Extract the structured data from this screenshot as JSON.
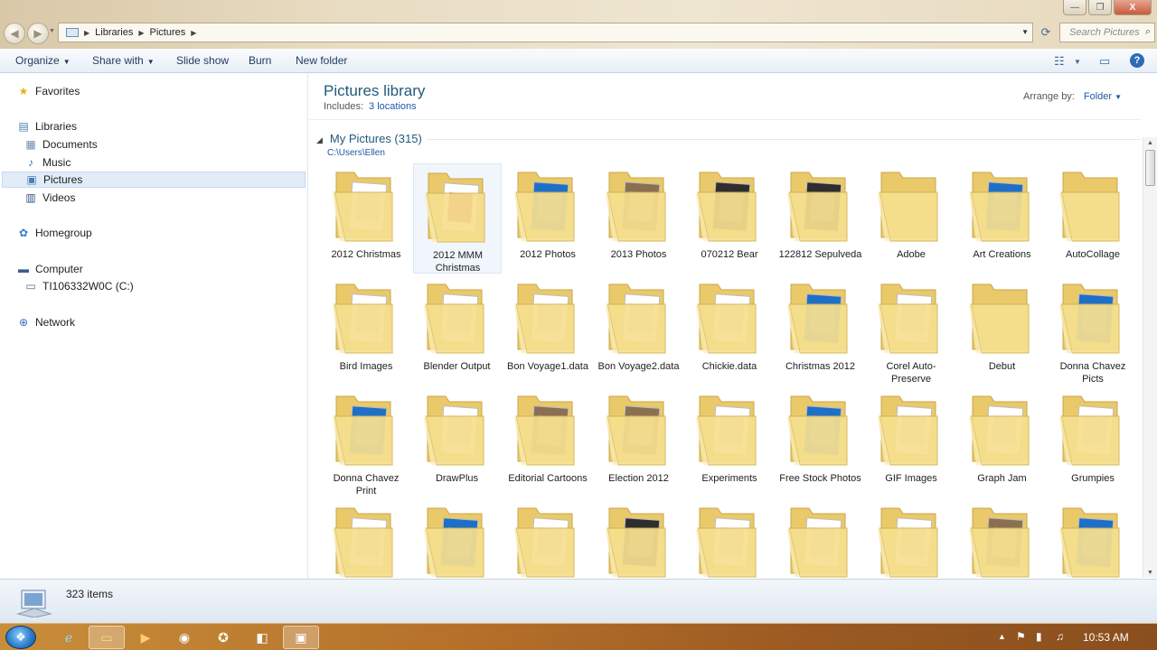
{
  "window": {
    "breadcrumb": [
      "Libraries",
      "Pictures"
    ],
    "search_placeholder": "Search Pictures",
    "buttons": {
      "minimize": "—",
      "maximize": "❐",
      "close": "X"
    }
  },
  "commands": {
    "organize": "Organize",
    "share_with": "Share with",
    "slide_show": "Slide show",
    "burn": "Burn",
    "new_folder": "New folder"
  },
  "nav": {
    "favorites": "Favorites",
    "libraries": "Libraries",
    "documents": "Documents",
    "music": "Music",
    "pictures": "Pictures",
    "videos": "Videos",
    "homegroup": "Homegroup",
    "computer": "Computer",
    "drive": "TI106332W0C (C:)",
    "network": "Network"
  },
  "library": {
    "title": "Pictures library",
    "includes_label": "Includes:",
    "includes_link": "3 locations",
    "arrange_label": "Arrange by:",
    "arrange_value": "Folder"
  },
  "group": {
    "title": "My Pictures (315)",
    "path": "C:\\Users\\Ellen"
  },
  "folders": [
    {
      "label": "2012 Christmas",
      "thumb": "white"
    },
    {
      "label": "2012 MMM Christmas",
      "thumb": "red"
    },
    {
      "label": "2012 Photos",
      "thumb": "blue"
    },
    {
      "label": "2013 Photos",
      "thumb": "photo"
    },
    {
      "label": "070212 Bear",
      "thumb": "dark"
    },
    {
      "label": "122812 Sepulveda",
      "thumb": "dark"
    },
    {
      "label": "Adobe",
      "thumb": "plain"
    },
    {
      "label": "Art Creations",
      "thumb": "blue"
    },
    {
      "label": "AutoCollage",
      "thumb": "plain"
    },
    {
      "label": "Bird Images",
      "thumb": "white"
    },
    {
      "label": "Blender Output",
      "thumb": "white"
    },
    {
      "label": "Bon Voyage1.data",
      "thumb": "white"
    },
    {
      "label": "Bon Voyage2.data",
      "thumb": "white"
    },
    {
      "label": "Chickie.data",
      "thumb": "white"
    },
    {
      "label": "Christmas 2012",
      "thumb": "blue"
    },
    {
      "label": "Corel Auto-Preserve",
      "thumb": "white"
    },
    {
      "label": "Debut",
      "thumb": "plain"
    },
    {
      "label": "Donna Chavez Picts",
      "thumb": "blue"
    },
    {
      "label": "Donna Chavez Print",
      "thumb": "blue"
    },
    {
      "label": "DrawPlus",
      "thumb": "white"
    },
    {
      "label": "Editorial Cartoons",
      "thumb": "photo"
    },
    {
      "label": "Election 2012",
      "thumb": "photo"
    },
    {
      "label": "Experiments",
      "thumb": "white"
    },
    {
      "label": "Free Stock Photos",
      "thumb": "blue"
    },
    {
      "label": "GIF Images",
      "thumb": "white"
    },
    {
      "label": "Graph Jam",
      "thumb": "white"
    },
    {
      "label": "Grumpies",
      "thumb": "white"
    },
    {
      "label": "",
      "thumb": "white"
    },
    {
      "label": "",
      "thumb": "blue"
    },
    {
      "label": "",
      "thumb": "white"
    },
    {
      "label": "",
      "thumb": "dark"
    },
    {
      "label": "",
      "thumb": "white"
    },
    {
      "label": "",
      "thumb": "white"
    },
    {
      "label": "",
      "thumb": "white"
    },
    {
      "label": "",
      "thumb": "photo"
    },
    {
      "label": "",
      "thumb": "blue"
    }
  ],
  "status": {
    "count": "323 items"
  },
  "taskbar": {
    "clock": "10:53 AM"
  }
}
